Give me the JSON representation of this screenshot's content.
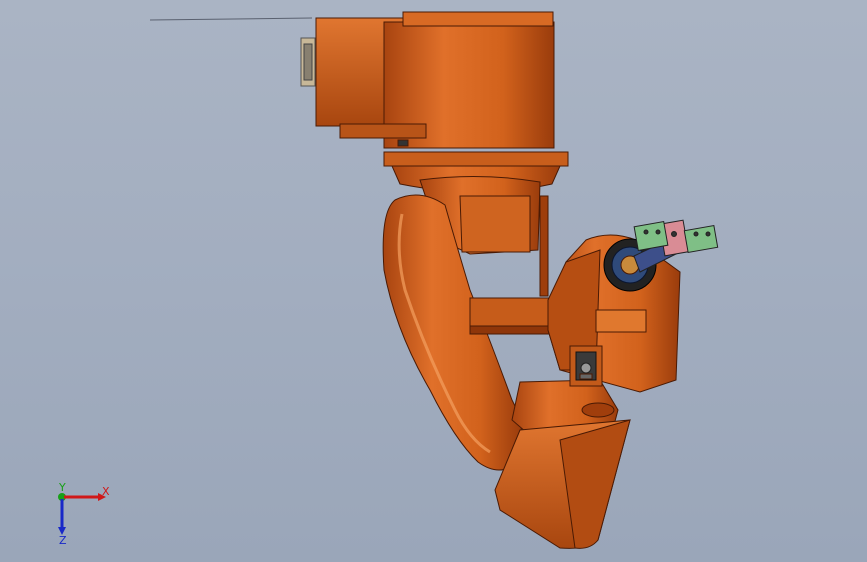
{
  "triad": {
    "x_label": "X",
    "y_label": "Y",
    "z_label": "Z",
    "x_color": "#d01818",
    "y_color": "#18a018",
    "z_color": "#1828c8"
  },
  "model": {
    "body_color": "#d8641c",
    "shadow_color": "#8a3408",
    "highlight_color": "#f08a40",
    "gripper_green": "#7fbf86",
    "gripper_pink": "#d98c95"
  }
}
